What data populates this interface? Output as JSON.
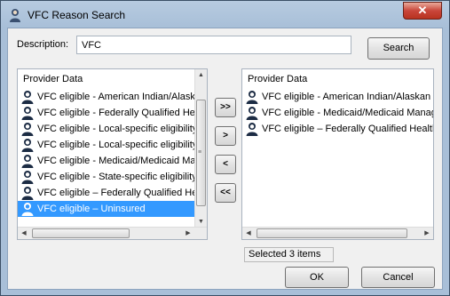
{
  "window": {
    "title": "VFC Reason Search",
    "close_label": "✕"
  },
  "search": {
    "label": "Description:",
    "value": "VFC",
    "button": "Search"
  },
  "left_list": {
    "header": "Provider Data",
    "items": [
      {
        "label": "VFC eligible - American Indian/Alaska",
        "selected": false
      },
      {
        "label": "VFC eligible - Federally Qualified Hea",
        "selected": false
      },
      {
        "label": "VFC eligible - Local-specific eligibility",
        "selected": false
      },
      {
        "label": "VFC eligible - Local-specific eligibility",
        "selected": false
      },
      {
        "label": "VFC eligible - Medicaid/Medicaid Mana",
        "selected": false
      },
      {
        "label": "VFC eligible - State-specific eligibility",
        "selected": false
      },
      {
        "label": "VFC eligible – Federally Qualified Hea",
        "selected": false
      },
      {
        "label": "VFC eligible – Uninsured",
        "selected": true
      }
    ]
  },
  "right_list": {
    "header": "Provider Data",
    "items": [
      {
        "label": "VFC eligible - American Indian/Alaskan N"
      },
      {
        "label": "VFC eligible - Medicaid/Medicaid Manage"
      },
      {
        "label": "VFC eligible – Federally Qualified Health C"
      }
    ]
  },
  "move_buttons": {
    "add_all": ">>",
    "add": ">",
    "remove": "<",
    "remove_all": "<<"
  },
  "status": "Selected 3 items",
  "footer": {
    "ok": "OK",
    "cancel": "Cancel"
  },
  "icons": {
    "title": "vfc-person-icon",
    "item": "person-icon"
  },
  "colors": {
    "selection": "#3399ff",
    "close": "#c9463a"
  }
}
